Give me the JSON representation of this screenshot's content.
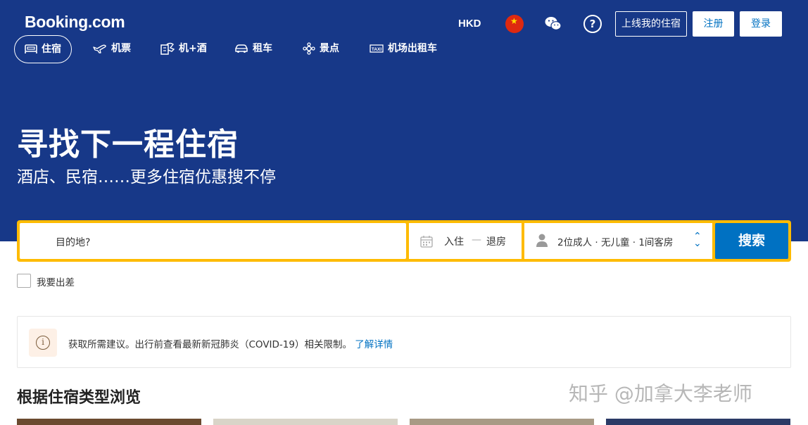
{
  "header": {
    "logo": "Booking.com",
    "currency": "HKD",
    "list_property": "上线我的住宿",
    "register": "注册",
    "login": "登录"
  },
  "nav": [
    {
      "label": "住宿",
      "icon": "bed-icon",
      "active": true
    },
    {
      "label": "机票",
      "icon": "plane-icon",
      "active": false
    },
    {
      "label": "机+酒",
      "icon": "flight-hotel-icon",
      "active": false
    },
    {
      "label": "租车",
      "icon": "car-icon",
      "active": false
    },
    {
      "label": "景点",
      "icon": "attractions-icon",
      "active": false
    },
    {
      "label": "机场出租车",
      "icon": "taxi-icon",
      "active": false
    }
  ],
  "hero": {
    "title": "寻找下一程住宿",
    "subtitle": "酒店、民宿……更多住宿优惠搜不停"
  },
  "search": {
    "destination_placeholder": "目的地?",
    "check_in": "入住",
    "date_sep": "—",
    "check_out": "退房",
    "guests": "2位成人 · 无儿童 · 1间客房",
    "button": "搜索"
  },
  "business_trip": "我要出差",
  "notice": {
    "text": "获取所需建议。出行前查看最新新冠肺炎（COVID-19）相关限制。",
    "link": "了解详情"
  },
  "section_title": "根据住宿类型浏览",
  "watermark": "知乎 @加拿大李老师",
  "colors": {
    "brand_blue": "#173888",
    "action_blue": "#0071c2",
    "search_yellow": "#febb02"
  }
}
